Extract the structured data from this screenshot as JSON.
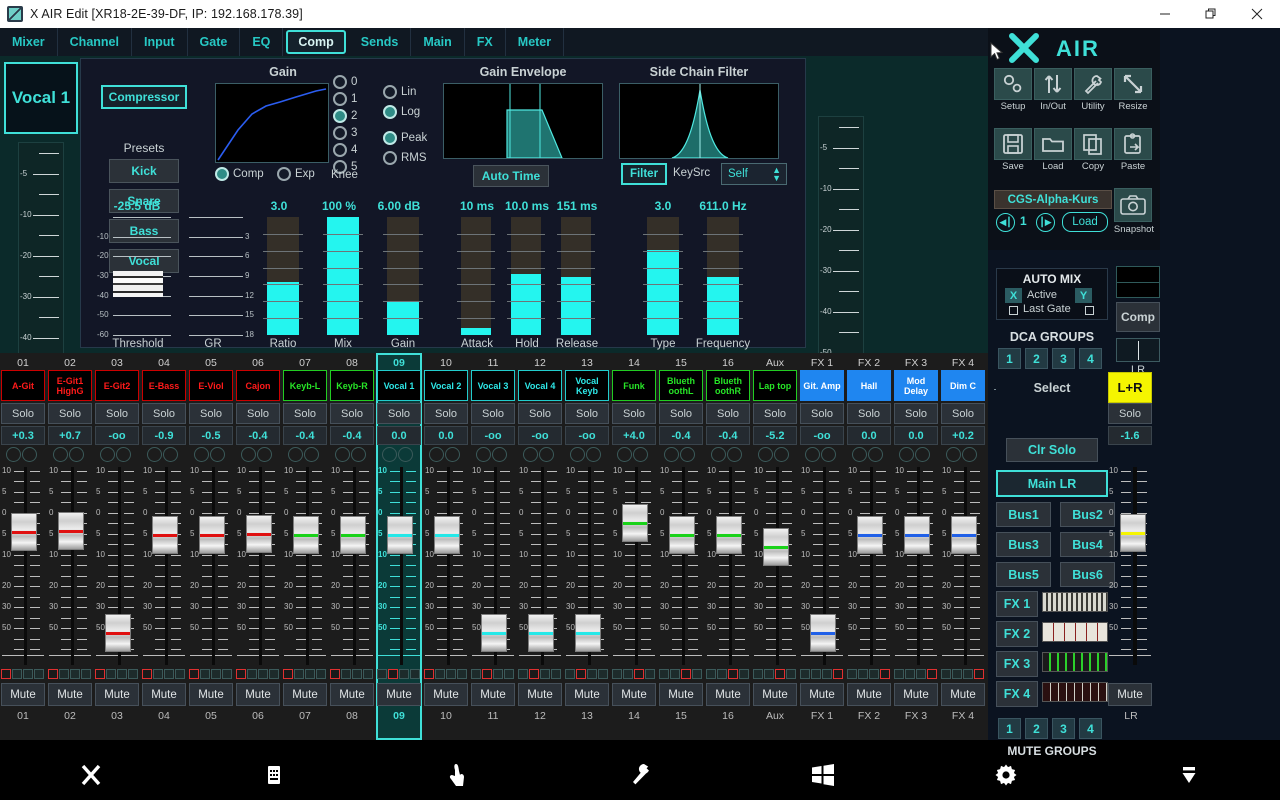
{
  "window": {
    "title": "X AIR Edit [XR18-2E-39-DF, IP: 192.168.178.39]",
    "app_icon": "xair-app-icon",
    "minimize": "minimize-icon",
    "maximize": "restore-icon",
    "close": "close-icon"
  },
  "menu": {
    "items": [
      {
        "label": "Mixer",
        "active": false
      },
      {
        "label": "Channel",
        "active": false
      },
      {
        "label": "Input",
        "active": false
      },
      {
        "label": "Gate",
        "active": false
      },
      {
        "label": "EQ",
        "active": false
      },
      {
        "label": "Comp",
        "active": true
      },
      {
        "label": "Sends",
        "active": false
      },
      {
        "label": "Main",
        "active": false
      },
      {
        "label": "FX",
        "active": false
      },
      {
        "label": "Meter",
        "active": false
      }
    ]
  },
  "processor": {
    "channel_label": "Vocal 1",
    "channel_number": "09",
    "right_meter_number": "09",
    "module_button": "Compressor",
    "presets_label": "Presets",
    "presets": [
      "Kick",
      "Snare",
      "Bass",
      "Vocal"
    ],
    "gain_title": "Gain",
    "gain_envelope_title": "Gain Envelope",
    "side_chain_title": "Side Chain Filter",
    "knee_label": "Knee",
    "knee_options": [
      "0",
      "1",
      "2",
      "3",
      "4",
      "5"
    ],
    "knee_selected": "2",
    "mode_options": [
      "Comp",
      "Exp"
    ],
    "mode_selected": "Comp",
    "detector_options": [
      "Lin",
      "Log"
    ],
    "detector_selected": "Log",
    "sense_options": [
      "Peak",
      "RMS"
    ],
    "sense_selected": "Peak",
    "auto_time_button": "Auto Time",
    "filter_button": "Filter",
    "keysrc_label": "KeySrc",
    "keysrc_value": "Self",
    "meter_scale": [
      "-5",
      "-10",
      "-20",
      "-30",
      "-40",
      "-50"
    ],
    "threshold": {
      "value": "-25.5 dB",
      "label": "Threshold",
      "scale": [
        "-10",
        "-20",
        "-30",
        "-40",
        "-50",
        "-60"
      ]
    },
    "gr": {
      "label": "GR",
      "scale": [
        "3",
        "6",
        "9",
        "12",
        "15",
        "18"
      ]
    },
    "ratio": {
      "value": "3.0",
      "label": "Ratio",
      "fill_pct": 45
    },
    "mix": {
      "value": "100 %",
      "label": "Mix",
      "fill_pct": 100
    },
    "gain": {
      "value": "6.00 dB",
      "label": "Gain",
      "fill_pct": 28
    },
    "attack": {
      "value": "10 ms",
      "label": "Attack",
      "fill_pct": 6
    },
    "hold": {
      "value": "10.0 ms",
      "label": "Hold",
      "fill_pct": 52
    },
    "release": {
      "value": "151 ms",
      "label": "Release",
      "fill_pct": 49
    },
    "type": {
      "value": "3.0",
      "label": "Type",
      "fill_pct": 72
    },
    "frequency": {
      "value": "611.0 Hz",
      "label": "Frequency",
      "fill_pct": 49
    }
  },
  "sidebar": {
    "logo_text": "AIR",
    "tools_row1": [
      {
        "label": "Setup",
        "icon": "gears-icon"
      },
      {
        "label": "In/Out",
        "icon": "arrows-updown-icon"
      },
      {
        "label": "Utility",
        "icon": "wrench-icon"
      },
      {
        "label": "Resize",
        "icon": "resize-diagonal-icon"
      }
    ],
    "tools_row2": [
      {
        "label": "Save",
        "icon": "floppy-icon"
      },
      {
        "label": "Load",
        "icon": "folder-icon"
      },
      {
        "label": "Copy",
        "icon": "copy-icon"
      },
      {
        "label": "Paste",
        "icon": "paste-icon"
      }
    ],
    "snapshot_name": "CGS-Alpha-Kurs",
    "snapshot_index": "1",
    "snapshot_load": "Load",
    "snapshot_label": "Snapshot",
    "prev_icon": "skip-previous-icon",
    "next_icon": "skip-next-icon",
    "camera_icon": "camera-icon",
    "automix": {
      "title": "AUTO MIX",
      "x_label": "X",
      "active_label": "Active",
      "y_label": "Y",
      "last_gate_label": "Last Gate"
    },
    "dca": {
      "title": "DCA GROUPS",
      "buttons": [
        "1",
        "2",
        "3",
        "4"
      ]
    },
    "select_label": "Select",
    "clr_solo": "Clr Solo",
    "buses": [
      {
        "label": "Main LR",
        "selected": true
      },
      {
        "label": "Bus1",
        "selected": false
      },
      {
        "label": "Bus2",
        "selected": false
      },
      {
        "label": "Bus3",
        "selected": false
      },
      {
        "label": "Bus4",
        "selected": false
      },
      {
        "label": "Bus5",
        "selected": false
      },
      {
        "label": "Bus6",
        "selected": false
      }
    ],
    "fx_slots": [
      {
        "label": "FX 1",
        "thumb": "fx-rack-guitar-amp"
      },
      {
        "label": "FX 2",
        "thumb": "fx-rack-hall-reverb"
      },
      {
        "label": "FX 3",
        "thumb": "fx-rack-mod-delay"
      },
      {
        "label": "FX 4",
        "thumb": "fx-rack-dimension-chorus"
      }
    ],
    "mute_groups": {
      "title": "MUTE GROUPS",
      "buttons": [
        "1",
        "2",
        "3",
        "4"
      ]
    },
    "master": {
      "lr_button": "L+R",
      "solo": "Solo",
      "level": "-1.6",
      "comp_label": "Comp",
      "lr_label": "LR",
      "mute": "Mute",
      "mute_foot": "LR",
      "scale": [
        "10",
        "20",
        "30",
        "50"
      ]
    }
  },
  "mixer": {
    "fader_scale": [
      "10",
      "5",
      "0",
      "5",
      "10",
      "20",
      "30",
      "50"
    ],
    "solo_label": "Solo",
    "mute_label": "Mute",
    "channels": [
      {
        "num": "01",
        "name": "A-Git",
        "color": "red",
        "level": "+0.3",
        "fader_pct": 72,
        "knob": "red",
        "mg": 0,
        "selected": false
      },
      {
        "num": "02",
        "name": "E-Git1 HighG",
        "color": "red",
        "level": "+0.7",
        "fader_pct": 73,
        "knob": "red",
        "mg": 0,
        "selected": false
      },
      {
        "num": "03",
        "name": "E-Git2",
        "color": "red",
        "level": "-oo",
        "fader_pct": 5,
        "knob": "red",
        "mg": 0,
        "selected": false
      },
      {
        "num": "04",
        "name": "E-Bass",
        "color": "red",
        "level": "-0.9",
        "fader_pct": 70,
        "knob": "red",
        "mg": 0,
        "selected": false
      },
      {
        "num": "05",
        "name": "E-Viol",
        "color": "red",
        "level": "-0.5",
        "fader_pct": 70,
        "knob": "red",
        "mg": 0,
        "selected": false
      },
      {
        "num": "06",
        "name": "Cajon",
        "color": "red",
        "level": "-0.4",
        "fader_pct": 71,
        "knob": "red",
        "mg": 0,
        "selected": false
      },
      {
        "num": "07",
        "name": "Keyb-L",
        "color": "green",
        "level": "-0.4",
        "fader_pct": 70,
        "knob": "green",
        "mg": 0,
        "selected": false
      },
      {
        "num": "08",
        "name": "Keyb-R",
        "color": "green",
        "level": "-0.4",
        "fader_pct": 70,
        "knob": "green",
        "mg": 0,
        "selected": false
      },
      {
        "num": "09",
        "name": "Vocal 1",
        "color": "cyan",
        "level": "0.0",
        "fader_pct": 70,
        "knob": "cyan",
        "mg": 1,
        "selected": true
      },
      {
        "num": "10",
        "name": "Vocal 2",
        "color": "cyan",
        "level": "0.0",
        "fader_pct": 70,
        "knob": "cyan",
        "mg": 0,
        "selected": false
      },
      {
        "num": "11",
        "name": "Vocal 3",
        "color": "cyan",
        "level": "-oo",
        "fader_pct": 5,
        "knob": "cyan",
        "mg": 1,
        "selected": false
      },
      {
        "num": "12",
        "name": "Vocal 4",
        "color": "cyan",
        "level": "-oo",
        "fader_pct": 5,
        "knob": "cyan",
        "mg": 1,
        "selected": false
      },
      {
        "num": "13",
        "name": "Vocal Keyb",
        "color": "cyan",
        "level": "-oo",
        "fader_pct": 5,
        "knob": "cyan",
        "mg": 1,
        "selected": false
      },
      {
        "num": "14",
        "name": "Funk",
        "color": "green",
        "level": "+4.0",
        "fader_pct": 78,
        "knob": "green",
        "mg": 2,
        "selected": false
      },
      {
        "num": "15",
        "name": "Blueth oothL",
        "color": "green",
        "level": "-0.4",
        "fader_pct": 70,
        "knob": "green",
        "mg": 2,
        "selected": false
      },
      {
        "num": "16",
        "name": "Blueth oothR",
        "color": "green",
        "level": "-0.4",
        "fader_pct": 70,
        "knob": "green",
        "mg": 2,
        "selected": false
      },
      {
        "num": "Aux",
        "name": "Lap top",
        "color": "green",
        "level": "-5.2",
        "fader_pct": 62,
        "knob": "green",
        "mg": 2,
        "selected": false
      },
      {
        "num": "FX 1",
        "name": "Git. Amp",
        "color": "blue",
        "level": "-oo",
        "fader_pct": 5,
        "knob": "blue",
        "mg": 3,
        "selected": false
      },
      {
        "num": "FX 2",
        "name": "Hall",
        "color": "blue",
        "level": "0.0",
        "fader_pct": 70,
        "knob": "blue",
        "mg": 3,
        "selected": false
      },
      {
        "num": "FX 3",
        "name": "Mod Delay",
        "color": "blue",
        "level": "0.0",
        "fader_pct": 70,
        "knob": "blue",
        "mg": 3,
        "selected": false
      },
      {
        "num": "FX 4",
        "name": "Dim C",
        "color": "blue",
        "level": "+0.2",
        "fader_pct": 70,
        "knob": "blue",
        "mg": 3,
        "selected": false
      }
    ]
  },
  "taskbar": {
    "items": [
      {
        "icon": "close-x-icon",
        "name": "close"
      },
      {
        "icon": "keyboard-icon",
        "name": "keyboard"
      },
      {
        "icon": "touch-hand-icon",
        "name": "touch"
      },
      {
        "icon": "wrench-icon",
        "name": "tools"
      },
      {
        "icon": "windows-icon",
        "name": "start"
      },
      {
        "icon": "gear-icon",
        "name": "settings"
      },
      {
        "icon": "chevron-down-icon",
        "name": "hide"
      }
    ]
  },
  "colors": {
    "accent": "#3fe0d8",
    "bar_fill": "#24f5ef",
    "panel_bg": "#121626",
    "teal_bg": "#0b2a2a",
    "yellow": "#f5f500",
    "blue_chan": "#1f86f0"
  }
}
